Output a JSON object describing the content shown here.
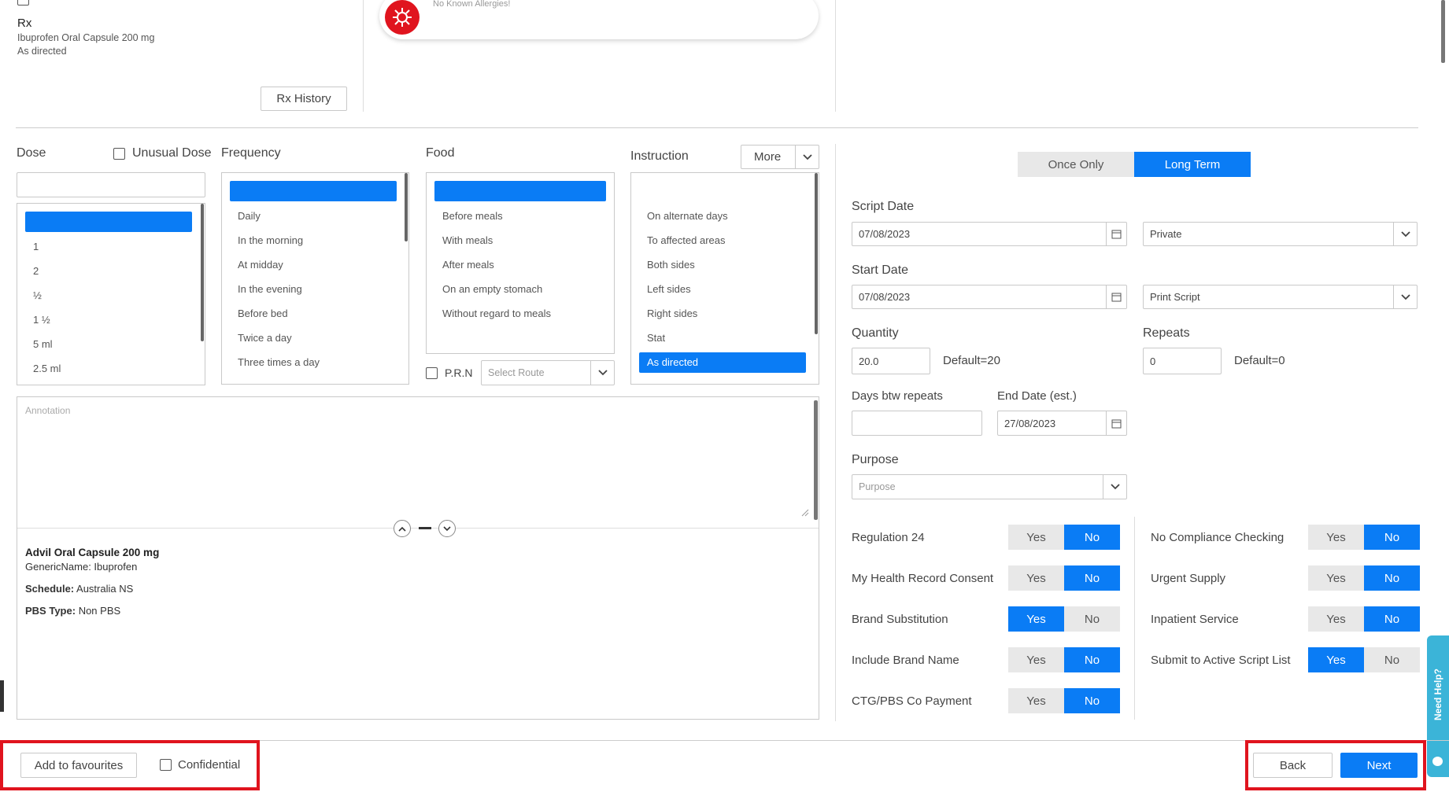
{
  "rx": {
    "heading": "Rx",
    "drug": "Ibuprofen Oral Capsule 200 mg",
    "directions": "As directed",
    "history_button": "Rx History"
  },
  "allergy": {
    "text": "No Known Allergies!",
    "icon": "virus-icon"
  },
  "dose": {
    "label": "Dose",
    "unusual_label": "Unusual Dose",
    "value": "",
    "options": [
      "",
      "1",
      "2",
      "½",
      "1 ½",
      "5 ml",
      "2.5 ml"
    ]
  },
  "frequency": {
    "label": "Frequency",
    "options": [
      "",
      "Daily",
      "In the morning",
      "At midday",
      "In the evening",
      "Before bed",
      "Twice a day",
      "Three times a day"
    ]
  },
  "food": {
    "label": "Food",
    "options": [
      "",
      "Before meals",
      "With meals",
      "After meals",
      "On an empty stomach",
      "Without regard to meals"
    ],
    "prn_label": "P.R.N",
    "route_placeholder": "Select Route"
  },
  "instruction": {
    "label": "Instruction",
    "more_button": "More",
    "options": [
      "",
      "On alternate days",
      "To affected areas",
      "Both sides",
      "Left sides",
      "Right sides",
      "Stat",
      "As directed"
    ],
    "selected": "As directed"
  },
  "annotation": {
    "placeholder": "Annotation"
  },
  "drug_info": {
    "name": "Advil Oral Capsule 200 mg",
    "generic": "GenericName: Ibuprofen",
    "schedule_label": "Schedule:",
    "schedule_value": "Australia NS",
    "pbs_label": "PBS Type:",
    "pbs_value": "Non PBS"
  },
  "script": {
    "once_only": "Once Only",
    "long_term": "Long Term",
    "script_date_label": "Script Date",
    "script_date": "07/08/2023",
    "script_type": "Private",
    "start_date_label": "Start Date",
    "start_date": "07/08/2023",
    "print_option": "Print Script",
    "quantity_label": "Quantity",
    "quantity": "20.0",
    "quantity_default": "Default=20",
    "repeats_label": "Repeats",
    "repeats": "0",
    "repeats_default": "Default=0",
    "days_btw_label": "Days btw repeats",
    "days_btw": "",
    "end_date_label": "End Date (est.)",
    "end_date": "27/08/2023",
    "purpose_label": "Purpose",
    "purpose_placeholder": "Purpose"
  },
  "toggles_left": [
    {
      "label": "Regulation 24",
      "value": "No"
    },
    {
      "label": "My Health Record Consent",
      "value": "No"
    },
    {
      "label": "Brand Substitution",
      "value": "Yes"
    },
    {
      "label": "Include Brand Name",
      "value": "No"
    },
    {
      "label": "CTG/PBS Co Payment",
      "value": "No"
    }
  ],
  "toggles_right": [
    {
      "label": "No Compliance Checking",
      "value": "No"
    },
    {
      "label": "Urgent Supply",
      "value": "No"
    },
    {
      "label": "Inpatient Service",
      "value": "No"
    },
    {
      "label": "Submit to Active Script List",
      "value": "Yes"
    }
  ],
  "yes_label": "Yes",
  "no_label": "No",
  "footer": {
    "favourites_button": "Add to favourites",
    "confidential_label": "Confidential",
    "back_button": "Back",
    "next_button": "Next"
  },
  "help_tab": "Need Help?",
  "colors": {
    "accent": "#0a7cf5",
    "highlight": "#e0141e",
    "help": "#3bb4d8"
  }
}
